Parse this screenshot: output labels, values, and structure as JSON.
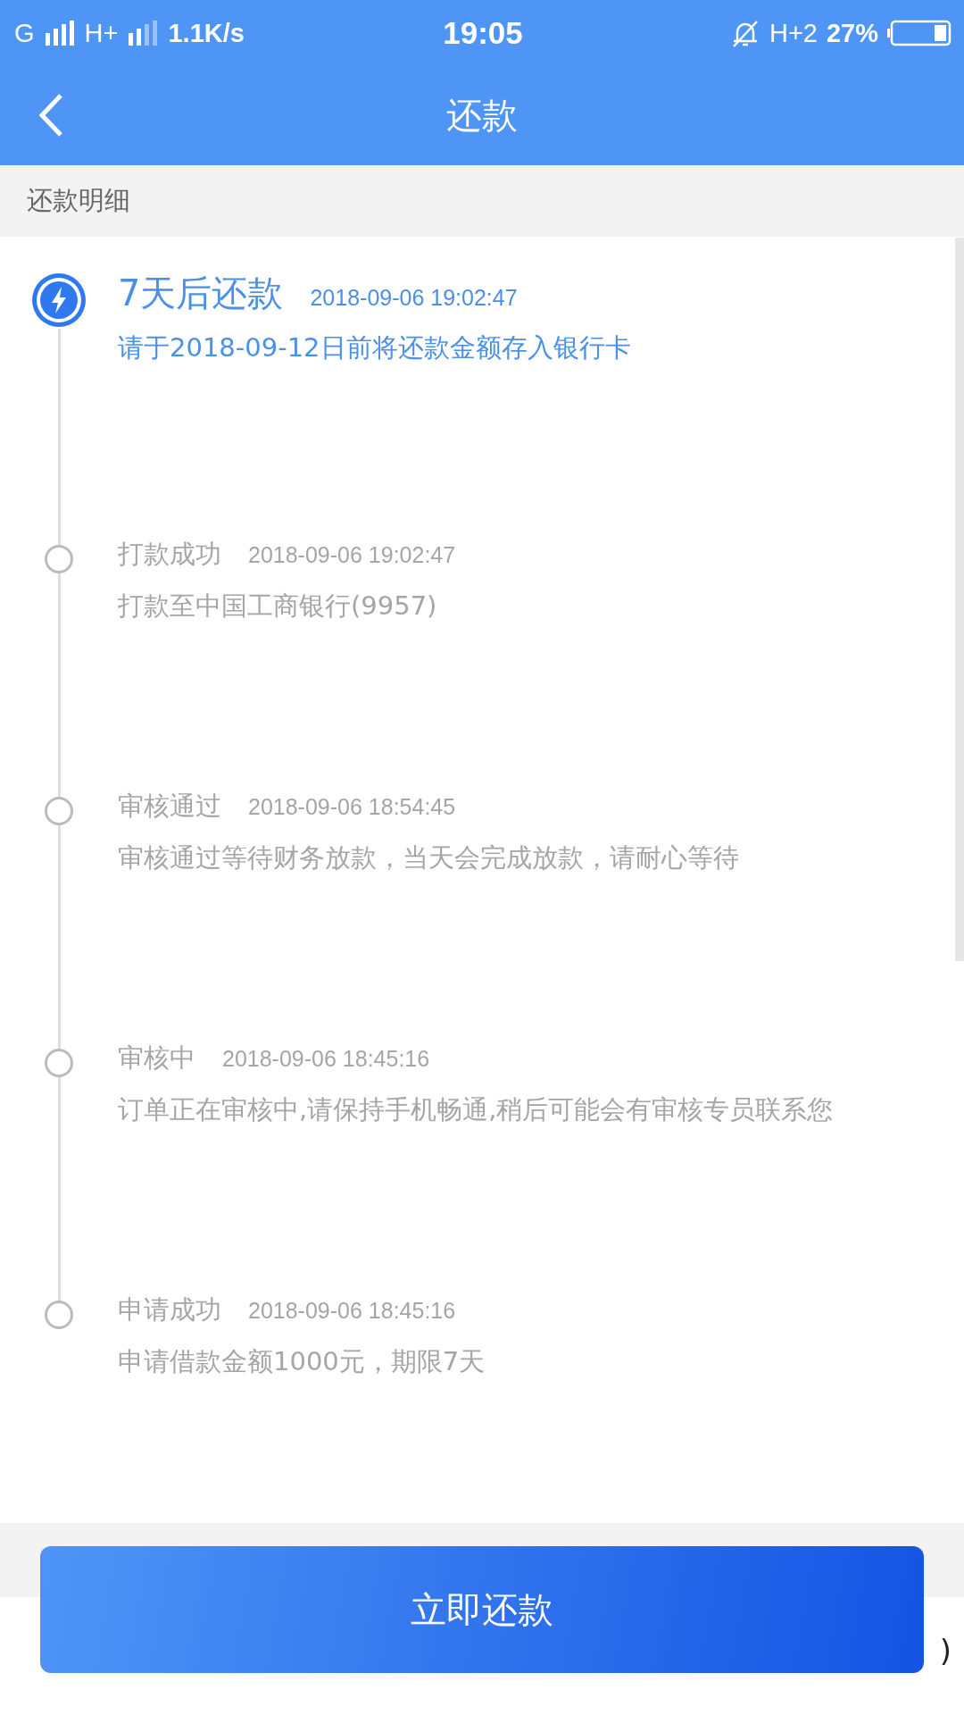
{
  "status_bar": {
    "network_1": "G",
    "network_2": "H+",
    "speed": "1.1K/s",
    "time": "19:05",
    "network_3": "H+2",
    "battery": "27%"
  },
  "nav": {
    "title": "还款"
  },
  "section": {
    "title": "还款明细"
  },
  "timeline": [
    {
      "title": "7天后还款",
      "time": "2018-09-06 19:02:47",
      "text": "请于2018-09-12日前将还款金额存入银行卡",
      "active": true
    },
    {
      "title": "打款成功",
      "time": "2018-09-06 19:02:47",
      "text": "打款至中国工商银行(9957)",
      "active": false
    },
    {
      "title": "审核通过",
      "time": "2018-09-06 18:54:45",
      "text": "审核通过等待财务放款，当天会完成放款，请耐心等待",
      "active": false
    },
    {
      "title": "审核中",
      "time": "2018-09-06 18:45:16",
      "text": "订单正在审核中,请保持手机畅通,稍后可能会有审核专员联系您",
      "active": false
    },
    {
      "title": "申请成功",
      "time": "2018-09-06 18:45:16",
      "text": "申请借款金额1000元，期限7天",
      "active": false
    }
  ],
  "row_value": ")",
  "button": "立即还款"
}
